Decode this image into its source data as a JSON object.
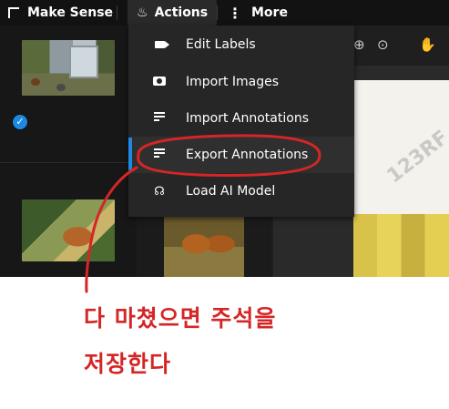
{
  "topbar": {
    "brand": "Make Sense",
    "actions_label": "Actions",
    "more_label": "More"
  },
  "menu": {
    "items": [
      {
        "label": "Edit Labels",
        "icon": "tag-icon"
      },
      {
        "label": "Import Images",
        "icon": "camera-icon"
      },
      {
        "label": "Import Annotations",
        "icon": "import-list-icon"
      },
      {
        "label": "Export Annotations",
        "icon": "export-list-icon",
        "active": true
      },
      {
        "label": "Load AI Model",
        "icon": "ai-brain-icon"
      }
    ]
  },
  "thumbnails": [
    {
      "state": "checked"
    },
    {
      "state": "unchecked"
    },
    {
      "state": "unchecked"
    }
  ],
  "annotation": {
    "line1": "다 마쳤으면 주석을",
    "line2": "저장한다",
    "color": "#d42626"
  },
  "watermark": "123RF",
  "colors": {
    "accent": "#1e88e5",
    "topbar": "#121212",
    "menu_bg": "#262626"
  }
}
